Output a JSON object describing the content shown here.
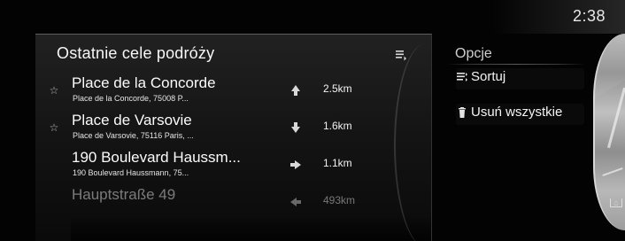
{
  "status_bar": {
    "clock": "2:38"
  },
  "recent_destinations": {
    "title": "Ostatnie cele podróży",
    "items": [
      {
        "title": "Place de la Concorde",
        "subtitle": "Place de la Concorde, 75008 P...",
        "direction": "up",
        "distance": "2.5km"
      },
      {
        "title": "Place de Varsovie",
        "subtitle": "Place de Varsovie, 75116 Paris, ...",
        "direction": "down",
        "distance": "1.6km"
      },
      {
        "title": "190 Boulevard Haussm...",
        "subtitle": "190 Boulevard Haussmann, 75...",
        "direction": "right",
        "distance": "1.1km"
      },
      {
        "title": "Hauptstraße 49",
        "subtitle": "",
        "direction": "left",
        "distance": "493km"
      }
    ]
  },
  "options": {
    "title": "Opcje",
    "sort_label": "Sortuj",
    "delete_all_label": "Usuń wszystkie"
  },
  "colors": {
    "background": "#030303",
    "panel_text": "#f7f7f7",
    "secondary_text": "#cfcfcf",
    "accent": "#8f8f8f"
  },
  "icons": {
    "star": "star-icon",
    "sort": "sort-icon",
    "trash": "trash-icon",
    "list": "list-icon"
  }
}
